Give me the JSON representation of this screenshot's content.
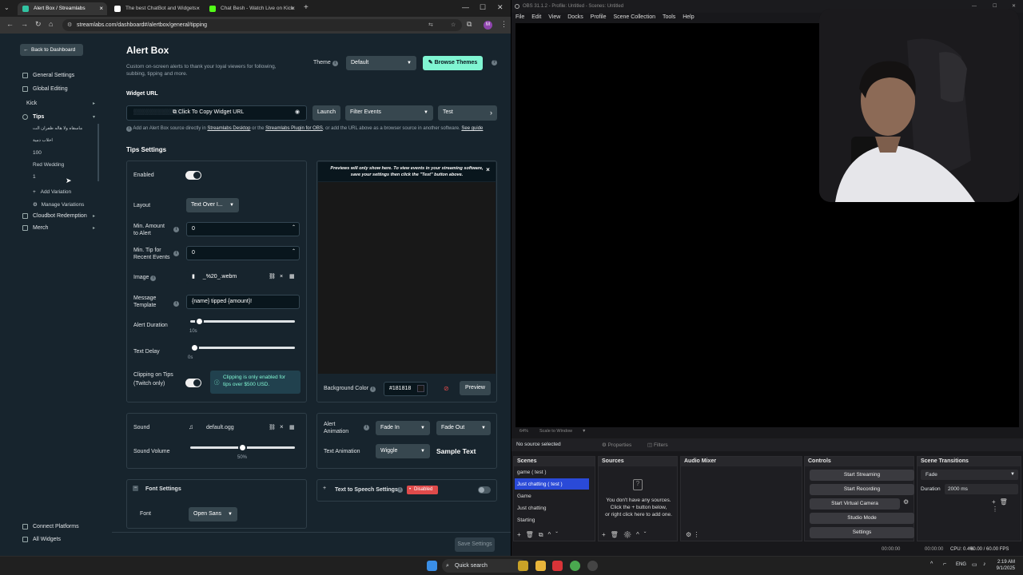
{
  "browser": {
    "tabs": [
      {
        "title": "Alert Box / Streamlabs",
        "active": true,
        "color": "#31c3a2"
      },
      {
        "title": "The best ChatBot and Widgets",
        "active": false,
        "color": "#ffffff"
      },
      {
        "title": "Chat Besh - Watch Live on Kick",
        "active": false,
        "color": "#53fc18"
      }
    ],
    "new_tab": "+",
    "url": "streamlabs.com/dashboard#/alertbox/general/tipping",
    "profile_initial": "M"
  },
  "sidebar": {
    "back_label": "Back to Dashboard",
    "general_settings": "General Settings",
    "global_editing": "Global Editing",
    "kick": "Kick",
    "tips": "Tips",
    "variations": [
      "ماسقاه ولا هاله ظفران الت",
      "احلاب دمية",
      "100",
      "Red Wedding",
      "1"
    ],
    "add_variation": "Add Variation",
    "manage_variations": "Manage Variations",
    "cloudbot": "Cloudbot Redemption",
    "merch": "Merch",
    "connect_platforms": "Connect Platforms",
    "all_widgets": "All Widgets"
  },
  "header": {
    "title": "Alert Box",
    "description": "Custom on-screen alerts to thank your loyal viewers for following, subbing, tipping and more.",
    "theme_label": "Theme",
    "theme_value": "Default",
    "browse_themes": "Browse Themes"
  },
  "widget_url": {
    "label": "Widget URL",
    "copy_text": "Click To Copy Widget URL",
    "launch": "Launch",
    "filter_events": "Filter Events",
    "test": "Test",
    "help_a": "Add an Alert Box source directly in",
    "help_link1": "Streamlabs Desktop",
    "help_b": "or the",
    "help_link2": "Streamlabs Plugin for OBS",
    "help_c": ", or add the URL above as a browser source in another software.",
    "help_link3": "See guide"
  },
  "tips_settings": {
    "title": "Tips Settings",
    "enabled_label": "Enabled",
    "layout_label": "Layout",
    "layout_value": "Text Over I...",
    "min_amount_label_1": "Min. Amount",
    "min_amount_label_2": "to Alert",
    "min_amount_value": "0",
    "min_tip_label_1": "Min. Tip for",
    "min_tip_label_2": "Recent Events",
    "min_tip_value": "0",
    "image_label": "Image",
    "image_value": "_%20_.webm",
    "message_label_1": "Message",
    "message_label_2": "Template",
    "message_value": "{name} tipped {amount}!",
    "alert_duration_label": "Alert Duration",
    "alert_duration_value": "10s",
    "alert_duration_level": 0.05,
    "text_delay_label": "Text Delay",
    "text_delay_value": "0s",
    "text_delay_level": 0.0,
    "clipping_label_1": "Clipping on Tips",
    "clipping_label_2": "(Twitch only)",
    "clipping_note_1": "Clipping is only enabled for",
    "clipping_note_2": "tips over $500 USD."
  },
  "preview_panel": {
    "notice_1": "Previews will only show here. To view events in your streaming software,",
    "notice_2": "save your settings then click the \"Test\" button above.",
    "bg_color_label": "Background Color",
    "bg_color_value": "#181818",
    "preview_btn": "Preview"
  },
  "sound": {
    "label": "Sound",
    "file": "default.ogg",
    "volume_label": "Sound Volume",
    "volume_value": "50%",
    "volume_level": 0.5
  },
  "animation": {
    "alert_animation_1": "Alert",
    "alert_animation_2": "Animation",
    "in_value": "Fade In",
    "out_value": "Fade Out",
    "text_animation_label": "Text Animation",
    "text_animation_value": "Wiggle",
    "sample_text": "Sample Text"
  },
  "font_settings": {
    "title": "Font Settings",
    "font_label": "Font",
    "font_value": "Open Sans"
  },
  "tts": {
    "title": "Text to Speech Settings",
    "badge": "Disabled"
  },
  "save_button": "Save Settings",
  "obs": {
    "title": "OBS 31.1.2 - Profile: Untitled - Scenes: Untitled",
    "menu": [
      "File",
      "Edit",
      "View",
      "Docks",
      "Profile",
      "Scene Collection",
      "Tools",
      "Help"
    ],
    "zoom": "64%",
    "scale": "Scale to Window",
    "no_source": "No source selected",
    "properties": "Properties",
    "filters": "Filters",
    "scenes_title": "Scenes",
    "scenes": [
      "game ( test )",
      "Just chatting ( test )",
      "Game",
      "Just chatting",
      "Starting"
    ],
    "selected_scene_index": 1,
    "sources_title": "Sources",
    "sources_empty_1": "You don't have any sources.",
    "sources_empty_2": "Click the + button below,",
    "sources_empty_3": "or right click here to add one.",
    "mixer_title": "Audio Mixer",
    "controls_title": "Controls",
    "controls": [
      "Start Streaming",
      "Start Recording",
      "Start Virtual Camera",
      "Studio Mode",
      "Settings"
    ],
    "transitions_title": "Scene Transitions",
    "transition_value": "Fade",
    "duration_label": "Duration",
    "duration_value": "2000 ms",
    "status": {
      "t1": "00:00:00",
      "t2": "00:00:00",
      "cpu": "CPU: 0.4%",
      "fps": "60.00 / 60.00 FPS"
    }
  },
  "taskbar": {
    "search": "Quick search",
    "lang": "ENG",
    "time": "2:19 AM",
    "date": "9/1/2025"
  },
  "colors": {
    "accent": "#80f5d2",
    "streamlabs_bg": "#17242d",
    "disabled_badge": "#e04b4b",
    "obs_selected": "#2a4ad8"
  }
}
